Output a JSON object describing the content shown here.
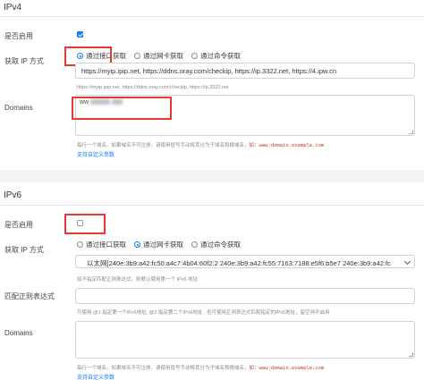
{
  "ipv4": {
    "title": "IPv4",
    "enable_label": "是否启用",
    "enabled": true,
    "get_ip_label": "获取 IP 方式",
    "methods": [
      "通过接口获取",
      "通过网卡获取",
      "通过命令获取"
    ],
    "selected_method": "通过接口获取",
    "url_value": "https://myip.ipip.net, https://ddns.oray.com/checkip, https://ip.3322.net, https://4.ipw.cn",
    "url_hint": "https://myip.ipip.net, https://ddns.oray.com/checkip, https://ip.3322.net",
    "domains_label": "Domains",
    "domains_value": "ww",
    "domains_hint": "每行一个域名。如果域名不可注册，请使用冒号手动将其分为子域名和根域名，",
    "domains_hint_example": "如：www:domain.example.com",
    "custom_params_link": "支持自定义参数"
  },
  "ipv6": {
    "title": "IPv6",
    "enable_label": "是否启用",
    "enabled": false,
    "get_ip_label": "获取 IP 方式",
    "methods": [
      "通过接口获取",
      "通过网卡获取",
      "通过命令获取"
    ],
    "selected_method": "通过网卡获取",
    "nic_value": "以太网[240e:3b9:a42:fc50:a4c7:4b04:60f2:2 240e:3b9:a42:fc55:7163:7188:e5f6:b5e7 240e:3b9:a42:fc",
    "nic_hint": "如不指定匹配正则表达式，则默认使用第一个 IPv6 地址",
    "regex_label": "匹配正则表达式",
    "regex_value": "",
    "regex_hint": "可使用 @1 指定第一个IPv6地址, @2 指定第二个IPv6地址...也可使用正则表达式匹配指定的IPv6地址，留空则不启用",
    "domains_label": "Domains",
    "domains_value": "",
    "domains_hint": "每行一个域名。如果域名不可注册，请使用冒号手动将其分为子域名和根域名，",
    "domains_hint_example": "如：www:domain.example.com",
    "custom_params_link": "支持自定义参数"
  },
  "colors": {
    "accent": "#1677ff",
    "highlight": "#e53935"
  }
}
